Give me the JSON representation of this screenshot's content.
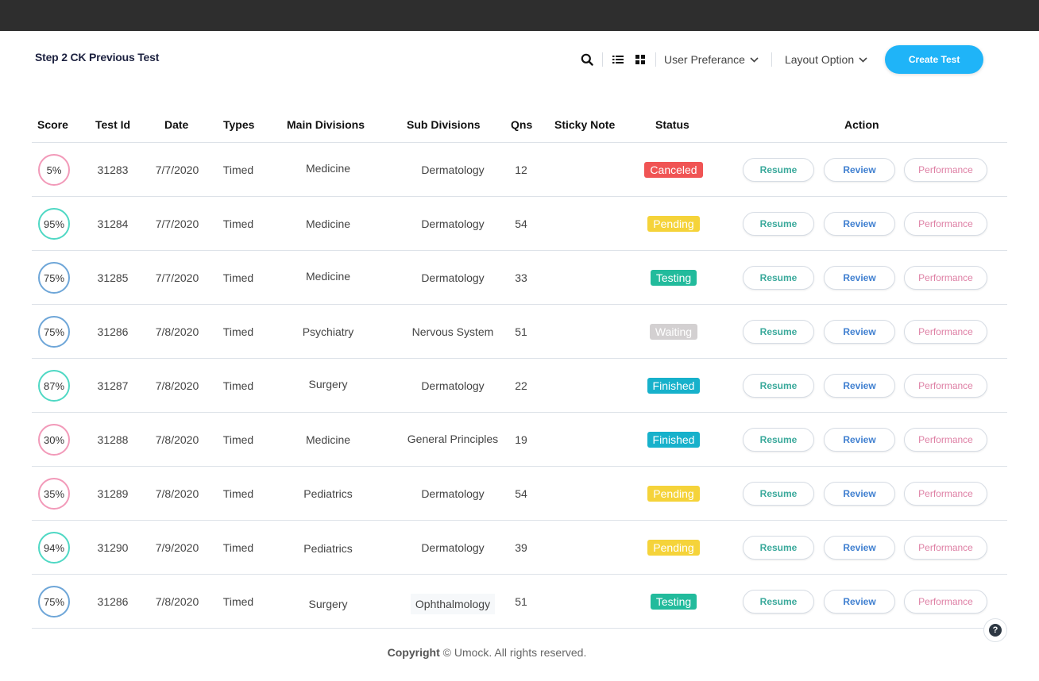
{
  "header": {
    "title": "Step 2 CK Previous Test",
    "icons": {
      "search": "search-icon",
      "list_view": "list-view-icon",
      "grid_view": "grid-view-icon"
    },
    "user_preference_label": "User Preferance",
    "layout_option_label": "Layout Option",
    "create_test_label": "Create Test"
  },
  "colors": {
    "topbar": "#2e2e2e",
    "accent": "#1fb4f8",
    "score_low": "#f29ab9",
    "score_high": "#4fd8c4",
    "score_mid": "#6ea6d8",
    "status_canceled": "#f05454",
    "status_pending": "#f5d33a",
    "status_testing": "#22bb9c",
    "status_waiting": "#d3d0d1",
    "status_finished": "#17b1cb"
  },
  "table": {
    "columns": [
      "Score",
      "Test Id",
      "Date",
      "Types",
      "Main Divisions",
      "Sub Divisions",
      "Qns",
      "Sticky Note",
      "Status",
      "Action"
    ],
    "action_labels": {
      "resume": "Resume",
      "review": "Review",
      "performance": "Performance"
    },
    "rows": [
      {
        "score": "5%",
        "score_level": "low",
        "test_id": "31283",
        "date": "7/7/2020",
        "type": "Timed",
        "main_division": "Medicine",
        "sub_division": "Dermatology",
        "qns": "12",
        "sticky_note": "",
        "status": "Canceled",
        "status_key": "canceled"
      },
      {
        "score": "95%",
        "score_level": "high",
        "test_id": "31284",
        "date": "7/7/2020",
        "type": "Timed",
        "main_division": "Medicine",
        "sub_division": "Dermatology",
        "qns": "54",
        "sticky_note": "",
        "status": "Pending",
        "status_key": "pending"
      },
      {
        "score": "75%",
        "score_level": "mid",
        "test_id": "31285",
        "date": "7/7/2020",
        "type": "Timed",
        "main_division": "Medicine",
        "sub_division": "Dermatology",
        "qns": "33",
        "sticky_note": "",
        "status": "Testing",
        "status_key": "testing"
      },
      {
        "score": "75%",
        "score_level": "mid",
        "test_id": "31286",
        "date": "7/8/2020",
        "type": "Timed",
        "main_division": "Psychiatry",
        "sub_division": "Nervous System",
        "qns": "51",
        "sticky_note": "",
        "status": "Waiting",
        "status_key": "waiting"
      },
      {
        "score": "87%",
        "score_level": "high",
        "test_id": "31287",
        "date": "7/8/2020",
        "type": "Timed",
        "main_division": "Surgery",
        "sub_division": "Dermatology",
        "qns": "22",
        "sticky_note": "",
        "status": "Finished",
        "status_key": "finished"
      },
      {
        "score": "30%",
        "score_level": "low",
        "test_id": "31288",
        "date": "7/8/2020",
        "type": "Timed",
        "main_division": "Medicine",
        "sub_division": "General Principles",
        "qns": "19",
        "sticky_note": "",
        "status": "Finished",
        "status_key": "finished"
      },
      {
        "score": "35%",
        "score_level": "low",
        "test_id": "31289",
        "date": "7/8/2020",
        "type": "Timed",
        "main_division": "Pediatrics",
        "sub_division": "Dermatology",
        "qns": "54",
        "sticky_note": "",
        "status": "Pending",
        "status_key": "pending"
      },
      {
        "score": "94%",
        "score_level": "high",
        "test_id": "31290",
        "date": "7/9/2020",
        "type": "Timed",
        "main_division": "Pediatrics",
        "sub_division": "Dermatology",
        "qns": "39",
        "sticky_note": "",
        "status": "Pending",
        "status_key": "pending"
      },
      {
        "score": "75%",
        "score_level": "mid",
        "test_id": "31286",
        "date": "7/8/2020",
        "type": "Timed",
        "main_division": "Surgery",
        "sub_division": "Ophthalmology",
        "qns": "51",
        "sticky_note": "",
        "status": "Testing",
        "status_key": "testing",
        "sub_division_highlighted": true
      }
    ]
  },
  "footer": {
    "copyright_bold": "Copyright",
    "copyright_rest": " © Umock. All rights reserved."
  },
  "help": {
    "icon": "help-icon",
    "label": "?"
  }
}
